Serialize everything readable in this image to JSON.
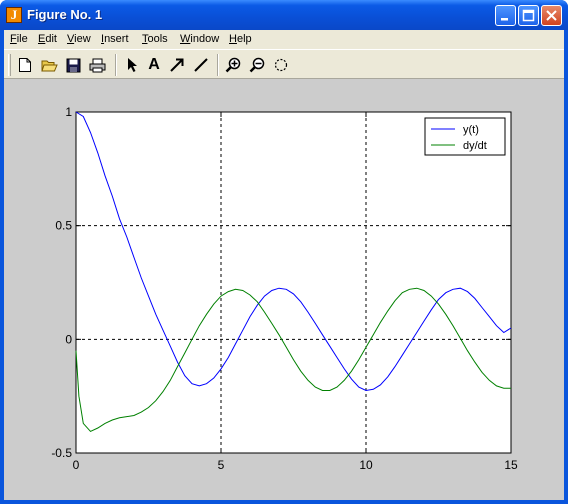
{
  "window": {
    "title": "Figure No. 1",
    "app_icon_glyph": "J"
  },
  "menu": [
    {
      "label": "File",
      "name": "menu-file"
    },
    {
      "label": "Edit",
      "name": "menu-edit"
    },
    {
      "label": "View",
      "name": "menu-view"
    },
    {
      "label": "Insert",
      "name": "menu-insert"
    },
    {
      "label": "Tools",
      "name": "menu-tools"
    },
    {
      "label": "Window",
      "name": "menu-window"
    },
    {
      "label": "Help",
      "name": "menu-help"
    }
  ],
  "toolbar": {
    "tools": [
      {
        "icon": "new-figure-icon"
      },
      {
        "icon": "open-file-icon"
      },
      {
        "icon": "save-icon"
      },
      {
        "icon": "print-icon"
      },
      {
        "icon": "edit-plot-arrow-icon"
      },
      {
        "icon": "insert-text-icon",
        "glyph": "A"
      },
      {
        "icon": "insert-arrow-icon"
      },
      {
        "icon": "insert-line-icon"
      },
      {
        "icon": "zoom-in-icon"
      },
      {
        "icon": "zoom-out-icon"
      },
      {
        "icon": "rotate-3d-icon"
      }
    ]
  },
  "chart_data": {
    "type": "line",
    "title": "",
    "xlabel": "",
    "ylabel": "",
    "xlim": [
      0,
      15
    ],
    "ylim": [
      -0.5,
      1
    ],
    "xticks": [
      0,
      5,
      10,
      15
    ],
    "yticks": [
      -0.5,
      0,
      0.5,
      1
    ],
    "xtick_labels": [
      "0",
      "5",
      "10",
      "15"
    ],
    "ytick_labels": [
      "-0.5",
      "0",
      "0.5",
      "1"
    ],
    "grid": true,
    "legend_position": "top-right",
    "series": [
      {
        "name": "y(t)",
        "color": "#0000ff",
        "x": [
          0,
          0.25,
          0.5,
          0.75,
          1,
          1.25,
          1.5,
          1.75,
          2,
          2.25,
          2.5,
          2.75,
          3,
          3.25,
          3.5,
          3.75,
          4,
          4.25,
          4.5,
          4.75,
          5,
          5.25,
          5.5,
          5.75,
          6,
          6.25,
          6.5,
          6.75,
          7,
          7.25,
          7.5,
          7.75,
          8,
          8.25,
          8.5,
          8.75,
          9,
          9.25,
          9.5,
          9.75,
          10,
          10.25,
          10.5,
          10.75,
          11,
          11.25,
          11.5,
          11.75,
          12,
          12.25,
          12.5,
          12.75,
          13,
          13.25,
          13.5,
          13.75,
          14,
          14.25,
          14.5,
          14.75,
          15
        ],
        "y": [
          1.0,
          0.98,
          0.91,
          0.82,
          0.72,
          0.63,
          0.53,
          0.45,
          0.36,
          0.27,
          0.19,
          0.11,
          0.04,
          -0.03,
          -0.1,
          -0.16,
          -0.195,
          -0.205,
          -0.195,
          -0.17,
          -0.13,
          -0.08,
          -0.02,
          0.04,
          0.1,
          0.15,
          0.19,
          0.215,
          0.225,
          0.22,
          0.2,
          0.165,
          0.12,
          0.07,
          0.02,
          -0.03,
          -0.08,
          -0.13,
          -0.175,
          -0.21,
          -0.225,
          -0.22,
          -0.2,
          -0.165,
          -0.12,
          -0.07,
          -0.02,
          0.03,
          0.08,
          0.13,
          0.175,
          0.205,
          0.22,
          0.225,
          0.21,
          0.18,
          0.14,
          0.1,
          0.06,
          0.03,
          0.05
        ]
      },
      {
        "name": "dy/dt",
        "color": "#008000",
        "x": [
          0,
          0.1,
          0.25,
          0.5,
          0.75,
          1,
          1.25,
          1.5,
          1.75,
          2,
          2.25,
          2.5,
          2.75,
          3,
          3.25,
          3.5,
          3.75,
          4,
          4.25,
          4.5,
          4.75,
          5,
          5.25,
          5.5,
          5.75,
          6,
          6.25,
          6.5,
          6.75,
          7,
          7.25,
          7.5,
          7.75,
          8,
          8.25,
          8.5,
          8.75,
          9,
          9.25,
          9.5,
          9.75,
          10,
          10.25,
          10.5,
          10.75,
          11,
          11.25,
          11.5,
          11.75,
          12,
          12.25,
          12.5,
          12.75,
          13,
          13.25,
          13.5,
          13.75,
          14,
          14.25,
          14.5,
          14.75,
          15
        ],
        "y": [
          -0.05,
          -0.25,
          -0.37,
          -0.405,
          -0.39,
          -0.37,
          -0.355,
          -0.345,
          -0.34,
          -0.335,
          -0.32,
          -0.3,
          -0.27,
          -0.23,
          -0.18,
          -0.12,
          -0.06,
          0.0,
          0.06,
          0.11,
          0.155,
          0.19,
          0.21,
          0.22,
          0.215,
          0.195,
          0.165,
          0.12,
          0.07,
          0.02,
          -0.035,
          -0.09,
          -0.14,
          -0.18,
          -0.21,
          -0.225,
          -0.225,
          -0.21,
          -0.18,
          -0.14,
          -0.09,
          -0.035,
          0.02,
          0.075,
          0.125,
          0.17,
          0.205,
          0.22,
          0.225,
          0.215,
          0.19,
          0.155,
          0.11,
          0.06,
          0.005,
          -0.05,
          -0.1,
          -0.145,
          -0.18,
          -0.205,
          -0.215,
          -0.215
        ]
      }
    ]
  }
}
